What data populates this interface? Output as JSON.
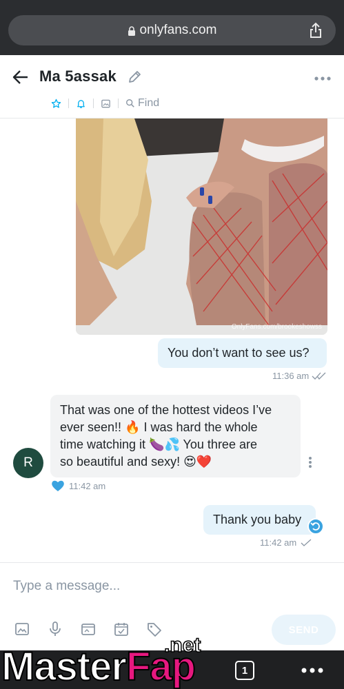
{
  "browser": {
    "url": "onlyfans.com"
  },
  "header": {
    "title": "Ma 5assak",
    "find_label": "Find"
  },
  "messages": [
    {
      "type": "media",
      "watermark": "OnlyFans.com/brookeshowss"
    },
    {
      "type": "outgoing",
      "text": "You don’t want to see us?",
      "time": "11:36 am"
    },
    {
      "type": "incoming",
      "line1": "That was one of the hottest videos I’ve",
      "line2": "ever seen!! 🔥 I was hard the whole",
      "line3": "time watching it 🍆💦 You three are",
      "line4": "so beautiful and sexy! 😍❤️",
      "time": "11:42 am",
      "avatar_letter": "R"
    },
    {
      "type": "outgoing",
      "text": "Thank you baby",
      "time": "11:42 am"
    }
  ],
  "composer": {
    "placeholder": "Type a message...",
    "send_label": "SEND"
  },
  "bottom_bar": {
    "tab_count": "1"
  },
  "watermark": {
    "brand_a": "Master",
    "brand_b": "Fap",
    "brand_suffix": ".net"
  },
  "colors": {
    "accent": "#00aff0",
    "outgoing_bubble": "#e5f3fb",
    "incoming_bubble": "#f2f3f4",
    "avatar": "#1f4b3f"
  }
}
